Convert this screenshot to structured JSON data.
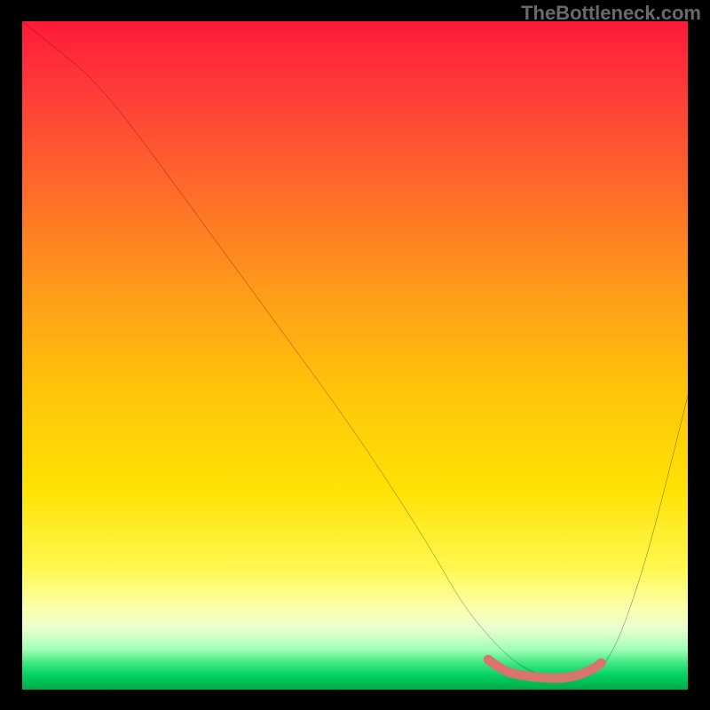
{
  "watermark": "TheBottleneck.com",
  "chart_data": {
    "type": "line",
    "title": "",
    "xlabel": "",
    "ylabel": "",
    "xlim": [
      0,
      100
    ],
    "ylim": [
      0,
      100
    ],
    "series": [
      {
        "name": "bottleneck-curve",
        "x": [
          0,
          5,
          10,
          16,
          27,
          38,
          49,
          57,
          62,
          66,
          70,
          74,
          78,
          82,
          86,
          89,
          92,
          95,
          100
        ],
        "y": [
          100,
          96,
          92,
          85,
          70,
          55,
          40,
          28,
          20,
          13,
          8,
          4,
          2,
          1.5,
          2,
          6,
          14,
          24,
          44
        ]
      },
      {
        "name": "optimal-band",
        "x": [
          70,
          72,
          74,
          76,
          78,
          80,
          82,
          84,
          86,
          87
        ],
        "y": [
          4.5,
          3,
          2.3,
          2,
          1.8,
          1.7,
          1.8,
          2.3,
          3.2,
          4
        ]
      }
    ],
    "gradient_stops": [
      {
        "pos": 0,
        "color": "#ff1a3a"
      },
      {
        "pos": 10,
        "color": "#ff3a3a"
      },
      {
        "pos": 25,
        "color": "#ff6a2a"
      },
      {
        "pos": 40,
        "color": "#ff9a1a"
      },
      {
        "pos": 55,
        "color": "#ffc40a"
      },
      {
        "pos": 70,
        "color": "#ffe205"
      },
      {
        "pos": 82,
        "color": "#fff850"
      },
      {
        "pos": 88,
        "color": "#fcffb0"
      },
      {
        "pos": 91,
        "color": "#e8ffd0"
      },
      {
        "pos": 94,
        "color": "#a0ffb8"
      },
      {
        "pos": 96,
        "color": "#40e880"
      },
      {
        "pos": 98,
        "color": "#00d060"
      },
      {
        "pos": 100,
        "color": "#00aa4a"
      }
    ],
    "curve_color": "#000000",
    "optimal_band_color": "#d9736e"
  }
}
